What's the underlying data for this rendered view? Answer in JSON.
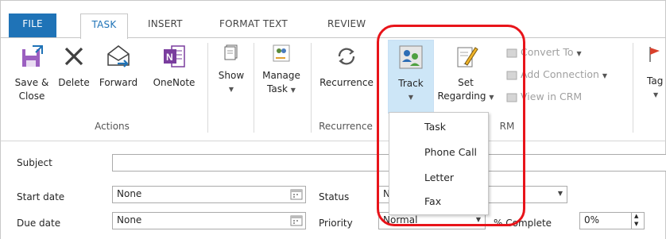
{
  "tabs": [
    {
      "label": "FILE"
    },
    {
      "label": "TASK"
    },
    {
      "label": "INSERT"
    },
    {
      "label": "FORMAT TEXT"
    },
    {
      "label": "REVIEW"
    }
  ],
  "ribbon": {
    "actions": {
      "group_label": "Actions",
      "save_close_line1": "Save &",
      "save_close_line2": "Close",
      "delete": "Delete",
      "forward": "Forward",
      "onenote": "OneNote"
    },
    "show": {
      "label": "Show"
    },
    "manage_task": {
      "line1": "Manage",
      "line2": "Task"
    },
    "recurrence": {
      "label": "Recurrence",
      "group_label": "Recurrence"
    },
    "crm": {
      "track": "Track",
      "set_line1": "Set",
      "set_line2": "Regarding",
      "convert_to": "Convert To",
      "add_connection": "Add Connection",
      "view_in_crm": "View in CRM",
      "group_label_partial": "RM"
    },
    "tags": {
      "label": "Tag"
    }
  },
  "track_menu": {
    "items": [
      "Task",
      "Phone Call",
      "Letter",
      "Fax"
    ]
  },
  "form": {
    "subject_label": "Subject",
    "subject_value": "",
    "start_date_label": "Start date",
    "start_date_value": "None",
    "due_date_label": "Due date",
    "due_date_value": "None",
    "status_label": "Status",
    "status_value": "N",
    "priority_label": "Priority",
    "priority_value": "Normal",
    "complete_label": "% Complete",
    "complete_value": "0%"
  },
  "colors": {
    "file_tab": "#1f73b7",
    "highlight_ring": "#e8141a",
    "track_selected": "#cde6f7"
  }
}
